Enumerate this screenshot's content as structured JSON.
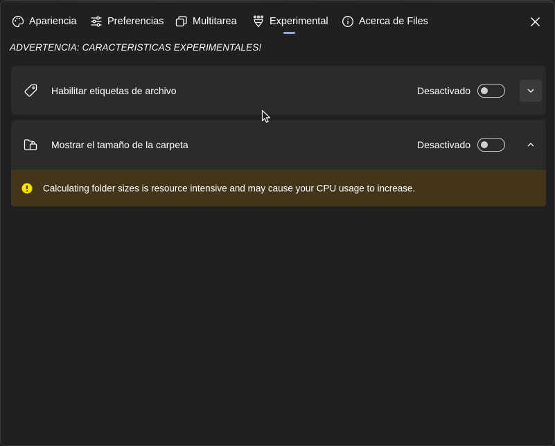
{
  "tabs": [
    {
      "label": "Apariencia",
      "icon": "palette-icon"
    },
    {
      "label": "Preferencias",
      "icon": "sliders-icon"
    },
    {
      "label": "Multitarea",
      "icon": "windows-stack-icon"
    },
    {
      "label": "Experimental",
      "icon": "beaker-icon",
      "selected": true
    },
    {
      "label": "Acerca de Files",
      "icon": "info-icon"
    }
  ],
  "warning_title": "ADVERTENCIA: CARACTERISTICAS EXPERIMENTALES!",
  "settings": [
    {
      "label": "Habilitar etiquetas de archivo",
      "icon": "tag-icon",
      "state_label": "Desactivado",
      "enabled": false,
      "expander": "chevron-down-icon"
    },
    {
      "label": "Mostrar el tamaño de la carpeta",
      "icon": "folder-size-icon",
      "state_label": "Desactivado",
      "enabled": false,
      "expander": "chevron-up-icon",
      "info": {
        "icon": "warning-icon",
        "text": "Calculating folder sizes is resource intensive and may cause your CPU usage to increase."
      }
    }
  ],
  "colors": {
    "background": "#202020",
    "card": "#2b2b2b",
    "infobar": "#433519",
    "accent_indicator": "#9aa5dd",
    "warning_icon": "#fce100"
  }
}
